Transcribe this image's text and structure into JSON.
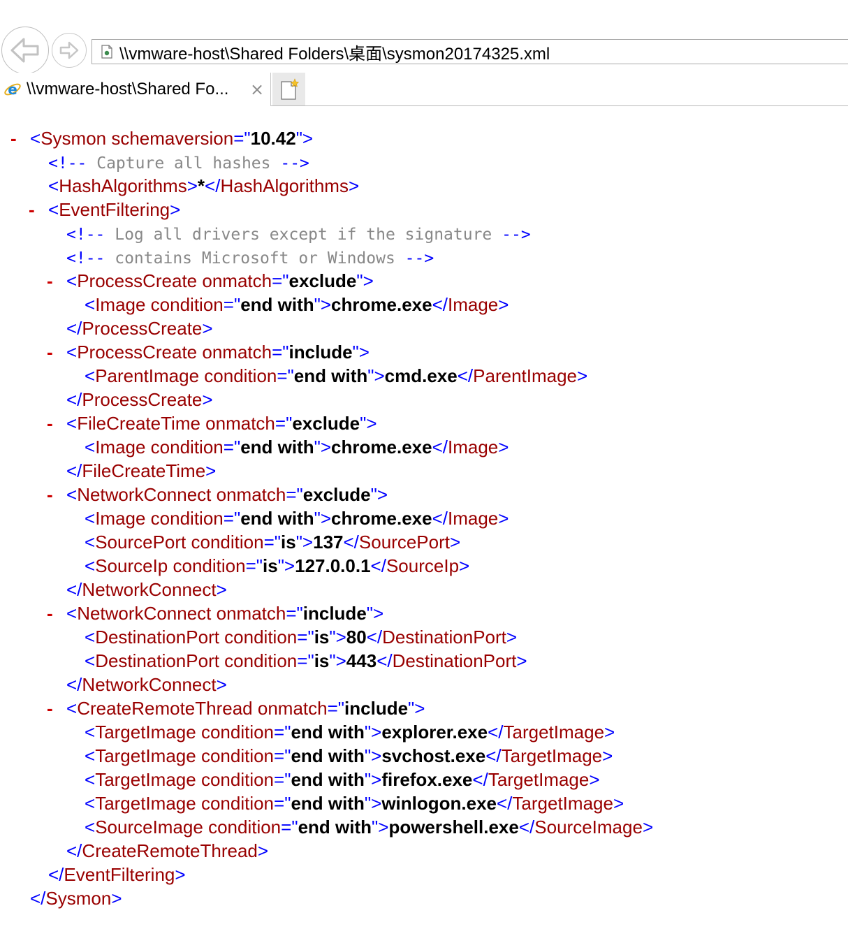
{
  "browser": {
    "address": "\\\\vmware-host\\Shared Folders\\桌面\\sysmon20174325.xml",
    "tab_title": "\\\\vmware-host\\Shared Fo...",
    "tab_close": "×"
  },
  "xml_lines": [
    {
      "indent": 0,
      "kind": "open",
      "name": "Sysmon",
      "attrs": [
        {
          "name": "schemaversion",
          "value": "10.42"
        }
      ],
      "collapsible": true
    },
    {
      "indent": 1,
      "kind": "comment",
      "text": " Capture all hashes "
    },
    {
      "indent": 1,
      "kind": "element",
      "name": "HashAlgorithms",
      "attrs": [],
      "text": "*"
    },
    {
      "indent": 1,
      "kind": "open",
      "name": "EventFiltering",
      "attrs": [],
      "collapsible": true
    },
    {
      "indent": 2,
      "kind": "comment",
      "text": " Log all drivers except if the signature "
    },
    {
      "indent": 2,
      "kind": "comment",
      "text": " contains Microsoft or Windows "
    },
    {
      "indent": 2,
      "kind": "open",
      "name": "ProcessCreate",
      "attrs": [
        {
          "name": "onmatch",
          "value": "exclude"
        }
      ],
      "collapsible": true
    },
    {
      "indent": 3,
      "kind": "element",
      "name": "Image",
      "attrs": [
        {
          "name": "condition",
          "value": "end with"
        }
      ],
      "text": "chrome.exe"
    },
    {
      "indent": 2,
      "kind": "close",
      "name": "ProcessCreate"
    },
    {
      "indent": 2,
      "kind": "open",
      "name": "ProcessCreate",
      "attrs": [
        {
          "name": "onmatch",
          "value": "include"
        }
      ],
      "collapsible": true
    },
    {
      "indent": 3,
      "kind": "element",
      "name": "ParentImage",
      "attrs": [
        {
          "name": "condition",
          "value": "end with"
        }
      ],
      "text": "cmd.exe"
    },
    {
      "indent": 2,
      "kind": "close",
      "name": "ProcessCreate"
    },
    {
      "indent": 2,
      "kind": "open",
      "name": "FileCreateTime",
      "attrs": [
        {
          "name": "onmatch",
          "value": "exclude"
        }
      ],
      "collapsible": true
    },
    {
      "indent": 3,
      "kind": "element",
      "name": "Image",
      "attrs": [
        {
          "name": "condition",
          "value": "end with"
        }
      ],
      "text": "chrome.exe"
    },
    {
      "indent": 2,
      "kind": "close",
      "name": "FileCreateTime"
    },
    {
      "indent": 2,
      "kind": "open",
      "name": "NetworkConnect",
      "attrs": [
        {
          "name": "onmatch",
          "value": "exclude"
        }
      ],
      "collapsible": true
    },
    {
      "indent": 3,
      "kind": "element",
      "name": "Image",
      "attrs": [
        {
          "name": "condition",
          "value": "end with"
        }
      ],
      "text": "chrome.exe"
    },
    {
      "indent": 3,
      "kind": "element",
      "name": "SourcePort",
      "attrs": [
        {
          "name": "condition",
          "value": "is"
        }
      ],
      "text": "137"
    },
    {
      "indent": 3,
      "kind": "element",
      "name": "SourceIp",
      "attrs": [
        {
          "name": "condition",
          "value": "is"
        }
      ],
      "text": "127.0.0.1"
    },
    {
      "indent": 2,
      "kind": "close",
      "name": "NetworkConnect"
    },
    {
      "indent": 2,
      "kind": "open",
      "name": "NetworkConnect",
      "attrs": [
        {
          "name": "onmatch",
          "value": "include"
        }
      ],
      "collapsible": true
    },
    {
      "indent": 3,
      "kind": "element",
      "name": "DestinationPort",
      "attrs": [
        {
          "name": "condition",
          "value": "is"
        }
      ],
      "text": "80"
    },
    {
      "indent": 3,
      "kind": "element",
      "name": "DestinationPort",
      "attrs": [
        {
          "name": "condition",
          "value": "is"
        }
      ],
      "text": "443"
    },
    {
      "indent": 2,
      "kind": "close",
      "name": "NetworkConnect"
    },
    {
      "indent": 2,
      "kind": "open",
      "name": "CreateRemoteThread",
      "attrs": [
        {
          "name": "onmatch",
          "value": "include"
        }
      ],
      "collapsible": true
    },
    {
      "indent": 3,
      "kind": "element",
      "name": "TargetImage",
      "attrs": [
        {
          "name": "condition",
          "value": "end with"
        }
      ],
      "text": "explorer.exe"
    },
    {
      "indent": 3,
      "kind": "element",
      "name": "TargetImage",
      "attrs": [
        {
          "name": "condition",
          "value": "end with"
        }
      ],
      "text": "svchost.exe"
    },
    {
      "indent": 3,
      "kind": "element",
      "name": "TargetImage",
      "attrs": [
        {
          "name": "condition",
          "value": "end with"
        }
      ],
      "text": "firefox.exe"
    },
    {
      "indent": 3,
      "kind": "element",
      "name": "TargetImage",
      "attrs": [
        {
          "name": "condition",
          "value": "end with"
        }
      ],
      "text": "winlogon.exe"
    },
    {
      "indent": 3,
      "kind": "element",
      "name": "SourceImage",
      "attrs": [
        {
          "name": "condition",
          "value": "end with"
        }
      ],
      "text": "powershell.exe"
    },
    {
      "indent": 2,
      "kind": "close",
      "name": "CreateRemoteThread"
    },
    {
      "indent": 1,
      "kind": "close",
      "name": "EventFiltering"
    },
    {
      "indent": 0,
      "kind": "close",
      "name": "Sysmon"
    }
  ]
}
